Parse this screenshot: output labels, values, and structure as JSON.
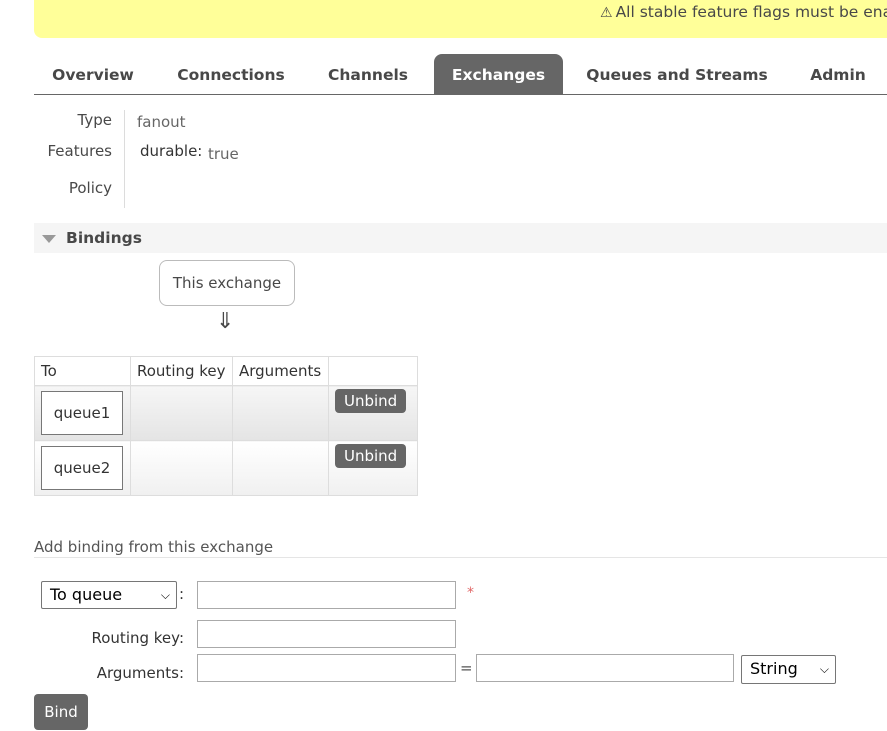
{
  "banner": {
    "icon": "warning-icon",
    "text": "All stable feature flags must be ena"
  },
  "tabs": [
    {
      "label": "Overview",
      "active": false
    },
    {
      "label": "Connections",
      "active": false
    },
    {
      "label": "Channels",
      "active": false
    },
    {
      "label": "Exchanges",
      "active": true
    },
    {
      "label": "Queues and Streams",
      "active": false
    },
    {
      "label": "Admin",
      "active": false
    }
  ],
  "details": {
    "type_label": "Type",
    "type_value": "fanout",
    "features_label": "Features",
    "durable_key": "durable:",
    "durable_value": "true",
    "policy_label": "Policy"
  },
  "bindings": {
    "section_title": "Bindings",
    "source_label": "This exchange",
    "arrow": "⇓",
    "columns": [
      "To",
      "Routing key",
      "Arguments",
      ""
    ],
    "rows": [
      {
        "to": "queue1",
        "routing_key": "",
        "arguments": "",
        "action": "Unbind"
      },
      {
        "to": "queue2",
        "routing_key": "",
        "arguments": "",
        "action": "Unbind"
      }
    ]
  },
  "add_binding": {
    "title": "Add binding from this exchange",
    "destination_type": "To queue",
    "destination_value": "",
    "required_marker": "*",
    "routing_key_label": "Routing key:",
    "routing_key_value": "",
    "arguments_label": "Arguments:",
    "argument_key": "",
    "equals": "=",
    "argument_value": "",
    "argument_type": "String",
    "colon": ":",
    "bind_label": "Bind"
  },
  "colors": {
    "banner": "#ffff99",
    "tab_active": "#666666",
    "button": "#666666",
    "required": "#e06666"
  }
}
